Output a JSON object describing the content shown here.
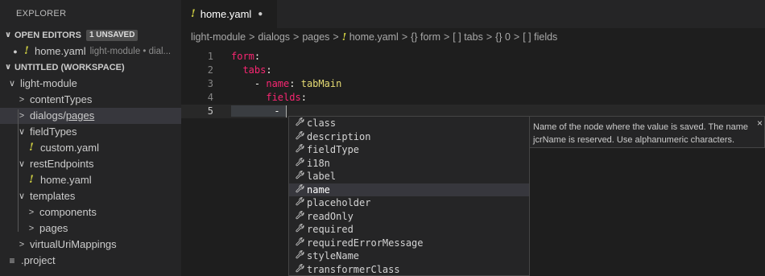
{
  "sidebar": {
    "title": "EXPLORER",
    "open_editors": {
      "label": "OPEN EDITORS",
      "badge": "1 UNSAVED"
    },
    "open_file": {
      "name": "home.yaml",
      "desc": "light-module • dial..."
    },
    "workspace": {
      "label": "UNTITLED (WORKSPACE)"
    },
    "tree": {
      "root": "light-module",
      "contentTypes": "contentTypes",
      "dialogs": "dialogs",
      "dialogs_slash": " / ",
      "pages": "pages",
      "fieldTypes": "fieldTypes",
      "custom_yaml": "custom.yaml",
      "restEndpoints": "restEndpoints",
      "home_yaml": "home.yaml",
      "templates": "templates",
      "components": "components",
      "pages2": "pages",
      "virtualUriMappings": "virtualUriMappings",
      "project": ".project"
    }
  },
  "tab": {
    "name": "home.yaml"
  },
  "breadcrumb": {
    "p1": "light-module",
    "p2": "dialogs",
    "p3": "pages",
    "p4": "home.yaml",
    "p5": "{} form",
    "p6": "[ ] tabs",
    "p7": "{} 0",
    "p8": "[ ] fields",
    "sep": ">"
  },
  "code": {
    "l1": {
      "n": "1",
      "key": "form",
      "colon": ":"
    },
    "l2": {
      "n": "2",
      "key": "tabs",
      "colon": ":"
    },
    "l3": {
      "n": "3",
      "dash": "- ",
      "key": "name",
      "colon": ": ",
      "value": "tabMain"
    },
    "l4": {
      "n": "4",
      "key": "fields",
      "colon": ":"
    },
    "l5": {
      "n": "5",
      "dash": "- "
    }
  },
  "suggestions": [
    "class",
    "description",
    "fieldType",
    "i18n",
    "label",
    "name",
    "placeholder",
    "readOnly",
    "required",
    "requiredErrorMessage",
    "styleName",
    "transformerClass"
  ],
  "suggest_selected": "name",
  "docs": {
    "text": "Name of the node where the value is saved. The name jcrName is reserved. Use alphanumeric characters.",
    "close": "×"
  },
  "icons": {
    "yaml": "!",
    "chevron_down": "∨",
    "chevron_right": ">",
    "wrench": "⚲",
    "lines": "≡",
    "dirty_dot": "●"
  },
  "colors": {
    "yaml_icon": "#cbcb41",
    "keyword": "#f92672",
    "string": "#e6db74",
    "sidebar_bg": "#252526",
    "editor_bg": "#1e1e1e"
  }
}
